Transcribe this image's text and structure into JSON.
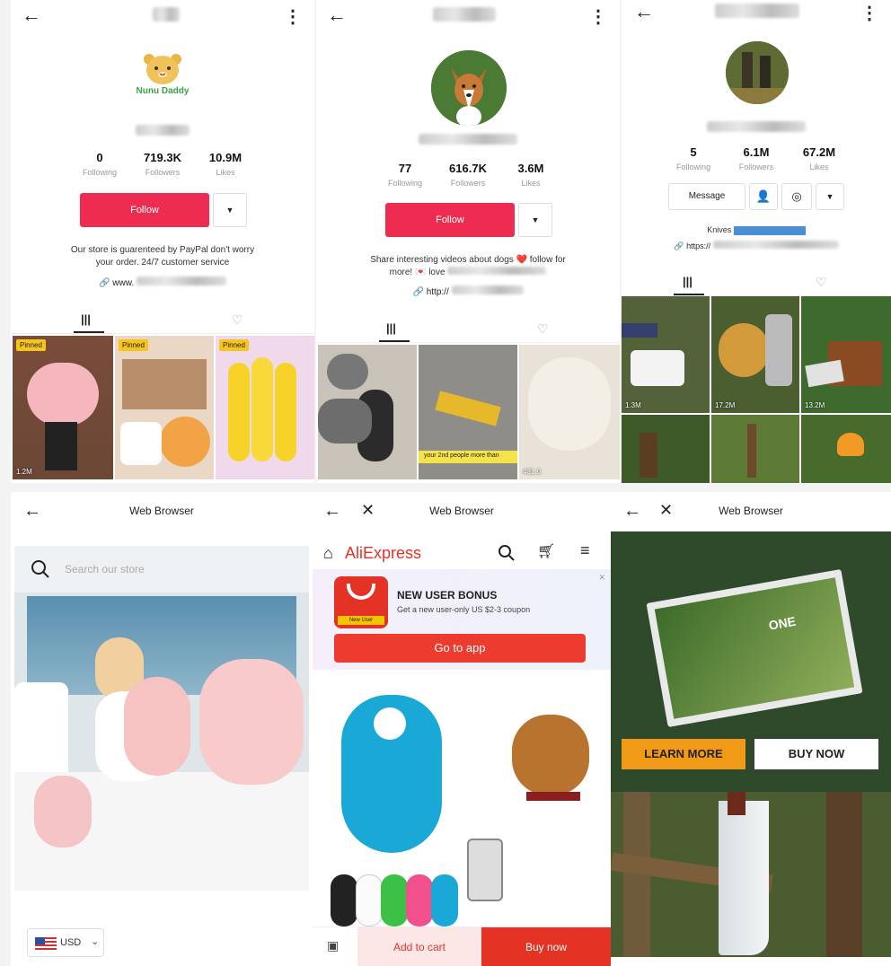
{
  "p1": {
    "stats": [
      {
        "num": "0",
        "label": "Following"
      },
      {
        "num": "719.3K",
        "label": "Followers"
      },
      {
        "num": "10.9M",
        "label": "Likes"
      }
    ],
    "logo_text": "Nunu Daddy",
    "follow": "Follow",
    "bio_line1": "Our store is guarenteed by PayPal don't worry",
    "bio_line2": "your order. 24/7 customer service",
    "link_prefix": "www.",
    "pinned": "Pinned",
    "thumb_plays": [
      "1.2M",
      "",
      ""
    ]
  },
  "p2": {
    "stats": [
      {
        "num": "77",
        "label": "Following"
      },
      {
        "num": "616.7K",
        "label": "Followers"
      },
      {
        "num": "3.6M",
        "label": "Likes"
      }
    ],
    "follow": "Follow",
    "bio_line1": "Share interesting videos about dogs ❤️ follow for",
    "bio_line2": "more! 💌 love",
    "link_prefix": "http://",
    "thumb_plays": [
      "",
      "",
      "431.0"
    ],
    "caption_strip": "your 2nd people more than"
  },
  "p3": {
    "stats": [
      {
        "num": "5",
        "label": "Following"
      },
      {
        "num": "6.1M",
        "label": "Followers"
      },
      {
        "num": "67.2M",
        "label": "Likes"
      }
    ],
    "message": "Message",
    "knives_label": "Knives",
    "link_prefix": "https://",
    "thumb_plays": [
      "1.3M",
      "17.2M",
      "13.2M"
    ]
  },
  "p4": {
    "title": "Web Browser",
    "search_placeholder": "Search our store",
    "currency": "USD"
  },
  "p5": {
    "title": "Web Browser",
    "brand": "AliExpress",
    "bonus_title": "NEW USER BONUS",
    "bonus_sub": "Get a new user-only US $2-3 coupon",
    "app_badge": "New User",
    "go_to_app": "Go to app",
    "add_to_cart": "Add to cart",
    "buy_now": "Buy now"
  },
  "p6": {
    "title": "Web Browser",
    "learn_more": "LEARN MORE",
    "buy_now": "BUY NOW",
    "book_text": "ONE"
  }
}
